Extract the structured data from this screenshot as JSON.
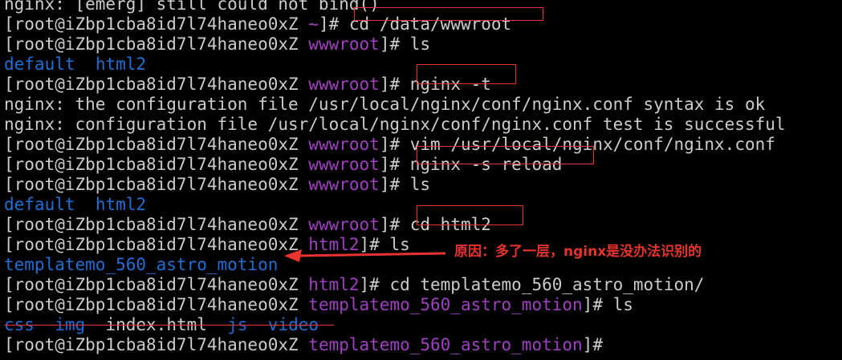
{
  "terminal": {
    "lines": [
      {
        "type": "plain",
        "text": "nginx: [emerg] still could not bind()"
      },
      {
        "type": "prompt",
        "user_host": "[root@iZbp1cba8id7l74haneo0xZ ",
        "cwd": "~",
        "cwd_color": "purple",
        "suffix": "]# ",
        "command": "cd /data/wwwroot"
      },
      {
        "type": "prompt",
        "user_host": "[root@iZbp1cba8id7l74haneo0xZ ",
        "cwd": "wwwroot",
        "cwd_color": "purple",
        "suffix": "]# ",
        "command": "ls"
      },
      {
        "type": "listing",
        "items": [
          {
            "text": "default",
            "color": "blue"
          },
          {
            "text": "  ",
            "color": "gray"
          },
          {
            "text": "html2",
            "color": "blue"
          }
        ]
      },
      {
        "type": "prompt",
        "user_host": "[root@iZbp1cba8id7l74haneo0xZ ",
        "cwd": "wwwroot",
        "cwd_color": "purple",
        "suffix": "]# ",
        "command": "nginx -t"
      },
      {
        "type": "plain",
        "text": "nginx: the configuration file /usr/local/nginx/conf/nginx.conf syntax is ok"
      },
      {
        "type": "plain",
        "text": "nginx: configuration file /usr/local/nginx/conf/nginx.conf test is successful"
      },
      {
        "type": "prompt",
        "user_host": "[root@iZbp1cba8id7l74haneo0xZ ",
        "cwd": "wwwroot",
        "cwd_color": "purple",
        "suffix": "]# ",
        "command": "vim /usr/local/nginx/conf/nginx.conf"
      },
      {
        "type": "prompt",
        "user_host": "[root@iZbp1cba8id7l74haneo0xZ ",
        "cwd": "wwwroot",
        "cwd_color": "purple",
        "suffix": "]# ",
        "command": "nginx -s reload"
      },
      {
        "type": "prompt",
        "user_host": "[root@iZbp1cba8id7l74haneo0xZ ",
        "cwd": "wwwroot",
        "cwd_color": "purple",
        "suffix": "]# ",
        "command": "ls"
      },
      {
        "type": "listing",
        "items": [
          {
            "text": "default",
            "color": "blue"
          },
          {
            "text": "  ",
            "color": "gray"
          },
          {
            "text": "html2",
            "color": "blue"
          }
        ]
      },
      {
        "type": "prompt",
        "user_host": "[root@iZbp1cba8id7l74haneo0xZ ",
        "cwd": "wwwroot",
        "cwd_color": "purple",
        "suffix": "]# ",
        "command": "cd html2"
      },
      {
        "type": "prompt",
        "user_host": "[root@iZbp1cba8id7l74haneo0xZ ",
        "cwd": "html2",
        "cwd_color": "purple",
        "suffix": "]# ",
        "command": "ls"
      },
      {
        "type": "listing",
        "items": [
          {
            "text": "templatemo_560_astro_motion",
            "color": "blue"
          }
        ]
      },
      {
        "type": "prompt",
        "user_host": "[root@iZbp1cba8id7l74haneo0xZ ",
        "cwd": "html2",
        "cwd_color": "purple",
        "suffix": "]# ",
        "command": "cd templatemo_560_astro_motion/"
      },
      {
        "type": "prompt",
        "user_host": "[root@iZbp1cba8id7l74haneo0xZ ",
        "cwd": "templatemo_560_astro_motion",
        "cwd_color": "purple",
        "suffix": "]# ",
        "command": "ls"
      },
      {
        "type": "listing",
        "items": [
          {
            "text": "css",
            "color": "blue"
          },
          {
            "text": "  ",
            "color": "gray"
          },
          {
            "text": "img",
            "color": "blue"
          },
          {
            "text": "  index.html  ",
            "color": "gray"
          },
          {
            "text": "js",
            "color": "blue"
          },
          {
            "text": "  ",
            "color": "gray"
          },
          {
            "text": "video",
            "color": "blue"
          }
        ]
      },
      {
        "type": "prompt",
        "user_host": "[root@iZbp1cba8id7l74haneo0xZ ",
        "cwd": "templatemo_560_astro_motion",
        "cwd_color": "purple",
        "suffix": "]# ",
        "command": ""
      }
    ]
  },
  "annotation": {
    "text": "原因：多了一层，nginx是没办法识别的",
    "color": "#e8332e"
  },
  "colors": {
    "background": "#000000",
    "text": "#cccccc",
    "dir_blue": "#1f6fd6",
    "dir_purple": "#a040c0",
    "highlight_red": "#e8332e"
  }
}
